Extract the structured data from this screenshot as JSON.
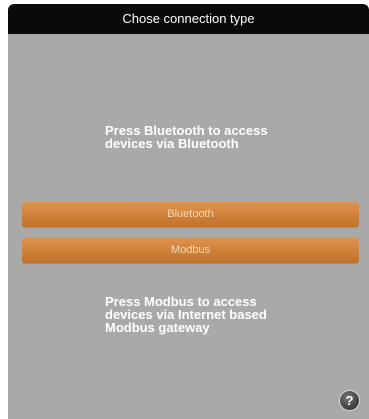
{
  "dialog": {
    "title": "Chose connection type",
    "bluetooth_info": "Press Bluetooth to access\ndevices via Bluetooth",
    "bluetooth_button": "Bluetooth",
    "modbus_button": "Modbus",
    "modbus_info": "Press Modbus to access\ndevices via Internet based\nModbus gateway",
    "help_glyph": "?"
  },
  "colors": {
    "titlebar": "#0a0a0a",
    "background": "#a9a9a9",
    "button": "#cf8138",
    "button_text": "#f4d9b8",
    "info_text": "#ffffff"
  },
  "icons": {
    "help": "help-icon"
  }
}
